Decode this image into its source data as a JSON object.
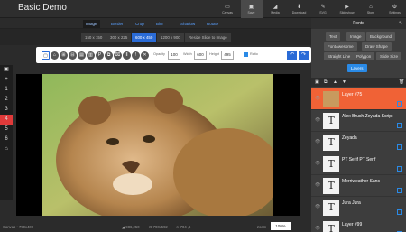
{
  "app": {
    "title": "Basic Demo"
  },
  "top_toolbar": [
    {
      "label": "Canvas",
      "icon": "canvas-icon",
      "glyph": "▭"
    },
    {
      "label": "Save",
      "icon": "save-icon",
      "glyph": "▣",
      "active": true
    },
    {
      "label": "Media",
      "icon": "media-icon",
      "glyph": "◢"
    },
    {
      "label": "Download",
      "icon": "download-icon",
      "glyph": "⬇"
    },
    {
      "label": "SVG",
      "icon": "svg-icon",
      "glyph": "✎"
    },
    {
      "label": "Slideshow",
      "icon": "slideshow-icon",
      "glyph": "▶"
    },
    {
      "label": "Store",
      "icon": "store-icon",
      "glyph": "⌂"
    },
    {
      "label": "Settings",
      "icon": "settings-icon",
      "glyph": "⚙"
    }
  ],
  "tabs": [
    {
      "label": "Image",
      "active": true
    },
    {
      "label": "Border"
    },
    {
      "label": "Crop"
    },
    {
      "label": "Blur"
    },
    {
      "label": "Shadow"
    },
    {
      "label": "Rotate"
    }
  ],
  "sizes": [
    {
      "label": "150 x 150"
    },
    {
      "label": "300 x 225"
    },
    {
      "label": "600 x 450",
      "active": true
    },
    {
      "label": "1200 x 900"
    },
    {
      "label": "Resize Slide to Image"
    }
  ],
  "tool_icons": [
    "▢",
    "⌂",
    "⊞",
    "⊟",
    "▤",
    "▥",
    "P",
    "⧉",
    "⌧",
    "‖",
    "!",
    "✕"
  ],
  "opacity": {
    "label": "Opacity",
    "value": "100"
  },
  "width": {
    "label": "Width",
    "value": "600"
  },
  "height": {
    "label": "Height",
    "value": "495"
  },
  "ratio": {
    "label": "Ratio"
  },
  "left_tools": [
    "▣",
    "+",
    "1",
    "2",
    "3",
    "4",
    "5",
    "6",
    "⌂"
  ],
  "status": {
    "canvas": "Canvas • 790x400",
    "position": "◢ 986,250",
    "size": "⊡ 790x592",
    "angle": "⊙ 704 ,6",
    "zoom_label": "zoom",
    "zoom": "100%"
  },
  "panel": {
    "title": "Fonts",
    "categories": [
      "Text",
      "Image",
      "Background",
      "FontAwesome",
      "Draw Shape",
      "Straight Line",
      "Polygon",
      "Slide Size",
      "Layers"
    ],
    "active_category": "Layers"
  },
  "layers": [
    {
      "name": "Layer #75",
      "type": "image",
      "selected": true
    },
    {
      "name": "Alex Brush Zeyada Script",
      "type": "text"
    },
    {
      "name": "Zeyada",
      "type": "text"
    },
    {
      "name": "PT Serif PT Serif",
      "type": "text"
    },
    {
      "name": "Merriweather Sans",
      "type": "text"
    },
    {
      "name": "Jura Jura",
      "type": "text"
    },
    {
      "name": "Layer #99",
      "type": "text"
    }
  ],
  "colors": {
    "accent": "#2a8ae6",
    "selected_layer": "#f06236",
    "active_left": "#e03a3a"
  }
}
